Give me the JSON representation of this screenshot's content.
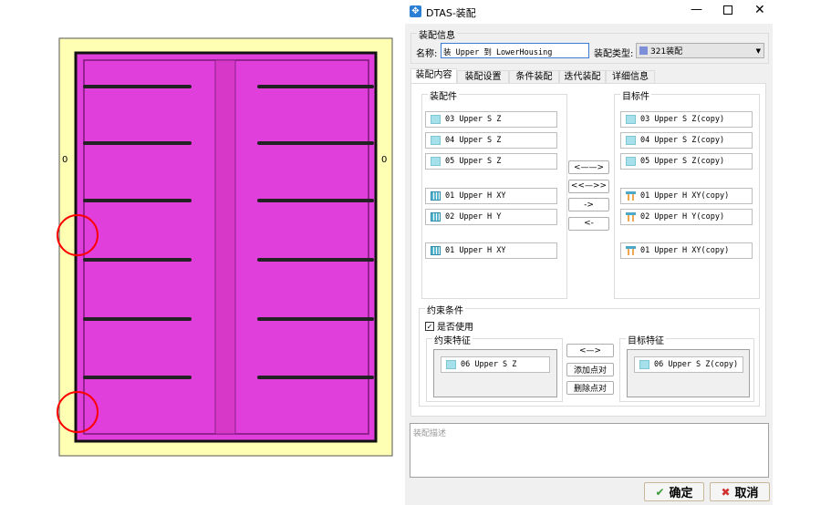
{
  "cad": {
    "plate_color": "#e03fdc",
    "background_color": "#ffffb4",
    "marker_left": "0",
    "marker_right": "0",
    "highlight_color": "#ff0000"
  },
  "dialog": {
    "title": "DTAS-装配",
    "icon": "dtas-app-icon",
    "info_group": "装配信息",
    "name_label": "名称:",
    "name_value": "装 Upper 到 LowerHousing",
    "type_label": "装配类型:",
    "type_value": "321装配",
    "tabs": [
      "装配内容",
      "装配设置",
      "条件装配",
      "迭代装配",
      "详细信息"
    ],
    "active_tab": 0,
    "parts_group": "装配件",
    "target_group": "目标件",
    "parts": [
      {
        "label": "03 Upper S Z",
        "icon": "s"
      },
      {
        "label": "04 Upper S Z",
        "icon": "s"
      },
      {
        "label": "05 Upper S Z",
        "icon": "s"
      },
      {
        "label": "01 Upper H XY",
        "icon": "h"
      },
      {
        "label": "02 Upper H Y",
        "icon": "h"
      },
      {
        "label": "01 Upper H XY",
        "icon": "h"
      }
    ],
    "targets": [
      {
        "label": "03 Upper S Z(copy)",
        "icon": "s"
      },
      {
        "label": "04 Upper S Z(copy)",
        "icon": "s"
      },
      {
        "label": "05 Upper S Z(copy)",
        "icon": "s"
      },
      {
        "label": "01 Upper H XY(copy)",
        "icon": "t"
      },
      {
        "label": "02 Upper H Y(copy)",
        "icon": "t"
      },
      {
        "label": "01 Upper H XY(copy)",
        "icon": "t"
      }
    ],
    "mid_buttons": [
      "<——>",
      "<<—>>",
      "->",
      "<-"
    ],
    "constraint_group": "约束条件",
    "use_checkbox": "是否使用",
    "use_checked": true,
    "constraint_feature_group": "约束特征",
    "target_feature_group": "目标特征",
    "constraint_feature": "06 Upper S Z",
    "target_feature": "06 Upper S Z(copy)",
    "pair_buttons": [
      "<—>",
      "添加点对",
      "删除点对"
    ],
    "description_placeholder": "装配描述",
    "ok": "确定",
    "cancel": "取消"
  }
}
